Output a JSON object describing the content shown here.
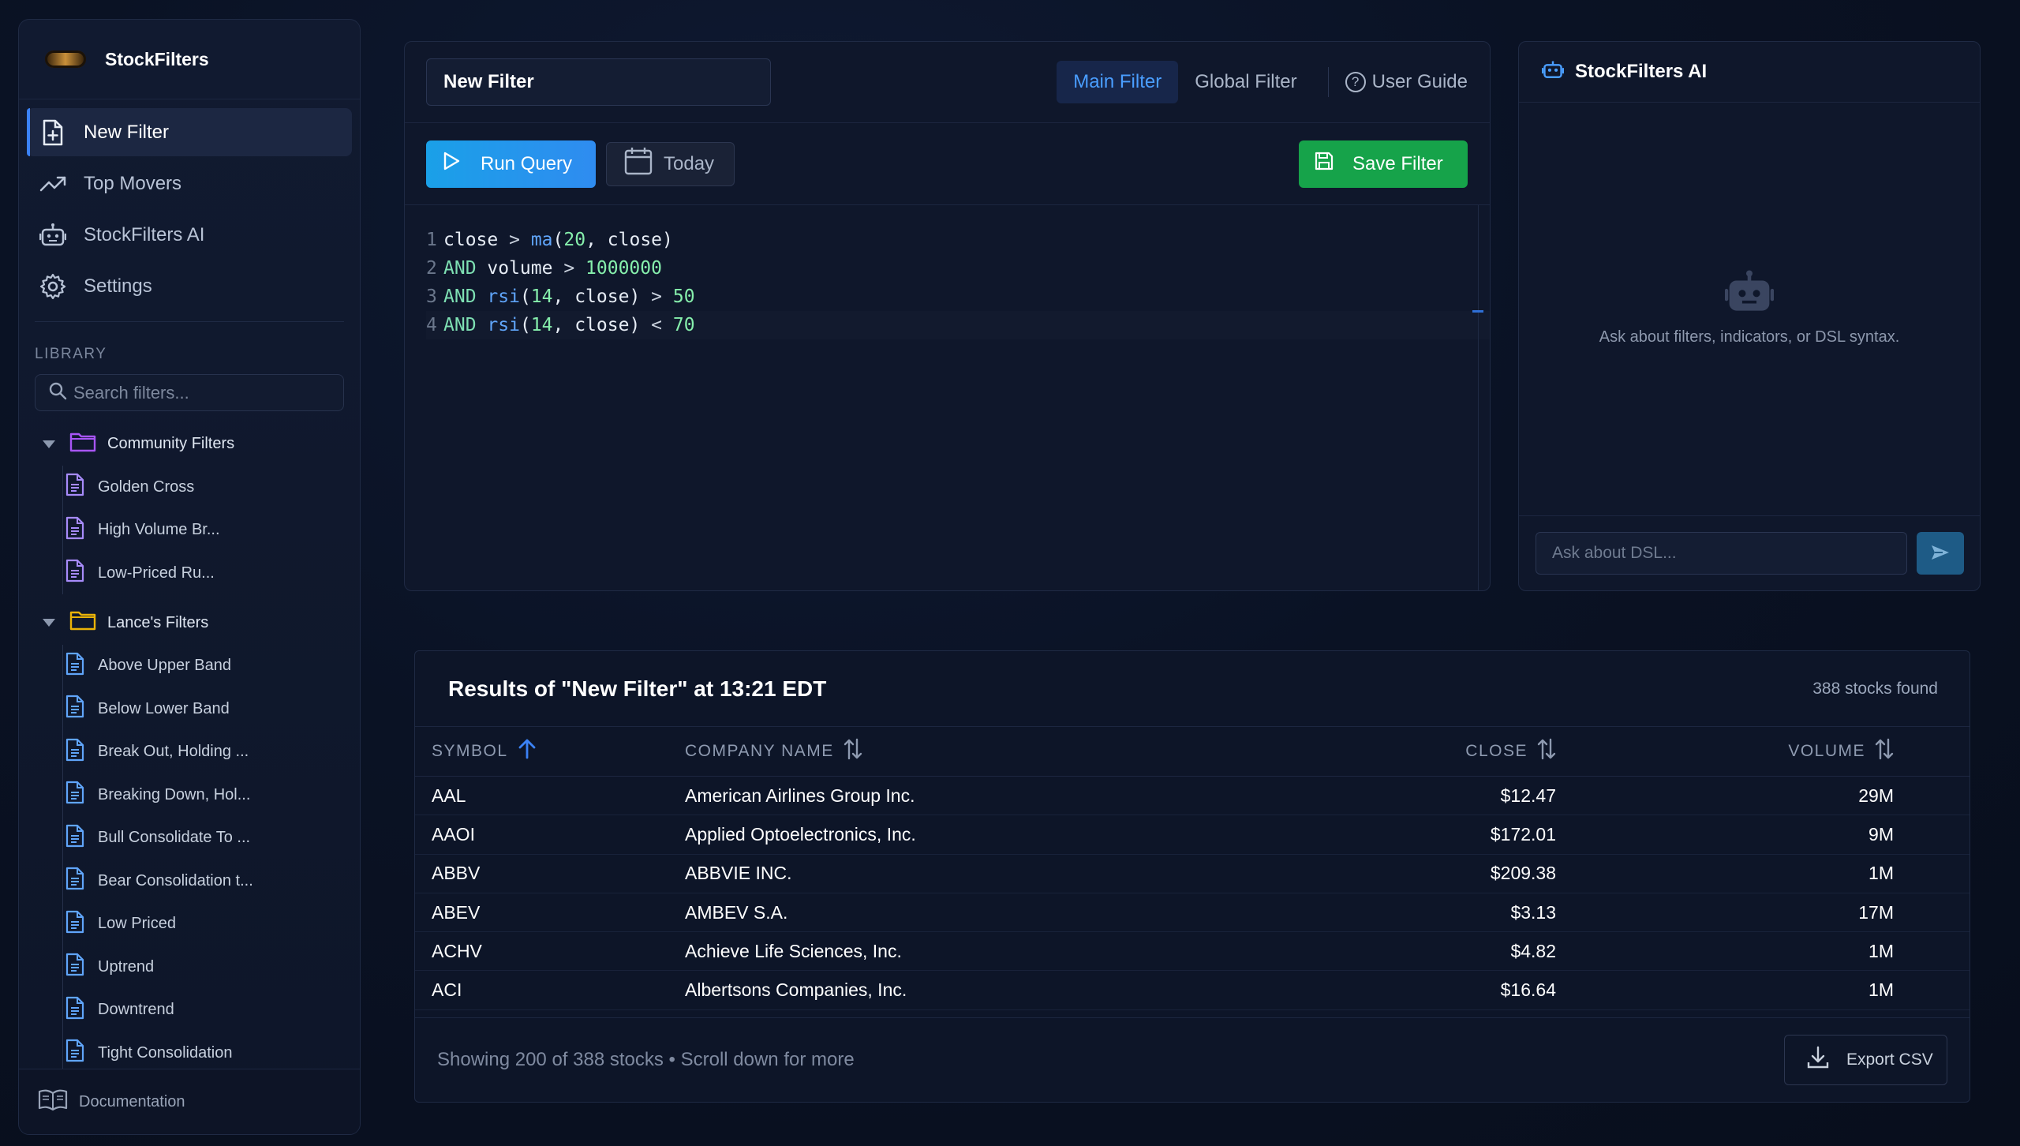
{
  "brand": {
    "name": "StockFilters"
  },
  "nav": {
    "items": [
      {
        "label": "New Filter",
        "icon": "file-plus-icon"
      },
      {
        "label": "Top Movers",
        "icon": "trending-up-icon"
      },
      {
        "label": "StockFilters AI",
        "icon": "robot-icon"
      },
      {
        "label": "Settings",
        "icon": "gear-icon"
      }
    ]
  },
  "library": {
    "label": "LIBRARY",
    "search_placeholder": "Search filters...",
    "folders": [
      {
        "name": "Community Filters",
        "color": "#a855f7",
        "files": [
          "Golden Cross",
          "High Volume Br...",
          "Low-Priced Ru..."
        ]
      },
      {
        "name": "Lance's Filters",
        "color": "#eab308",
        "files": [
          "Above Upper Band",
          "Below Lower Band",
          "Break Out, Holding ...",
          "Breaking Down, Hol...",
          "Bull Consolidate To ...",
          "Bear Consolidation t...",
          "Low Priced",
          "Uptrend",
          "Downtrend",
          "Tight Consolidation"
        ]
      }
    ],
    "file_color_purple": "#a78bfa",
    "file_color_blue": "#60a5fa"
  },
  "docs": {
    "label": "Documentation"
  },
  "editor": {
    "filter_name": "New Filter",
    "tabs": {
      "main": "Main Filter",
      "global": "Global Filter"
    },
    "user_guide": "User Guide",
    "run_label": "Run Query",
    "date_label": "Today",
    "save_label": "Save Filter",
    "code": [
      {
        "n": "1",
        "t": "close > ma(20, close)"
      },
      {
        "n": "2",
        "t": "AND volume > 1000000"
      },
      {
        "n": "3",
        "t": "AND rsi(14, close) > 50"
      },
      {
        "n": "4",
        "t": "AND rsi(14, close) < 70"
      }
    ]
  },
  "ai": {
    "title": "StockFilters AI",
    "empty_text": "Ask about filters, indicators, or DSL syntax.",
    "input_placeholder": "Ask about DSL..."
  },
  "results": {
    "title": "Results of \"New Filter\" at 13:21 EDT",
    "count": "388 stocks found",
    "columns": {
      "symbol": "SYMBOL",
      "company": "COMPANY NAME",
      "close": "CLOSE",
      "volume": "VOLUME"
    },
    "rows": [
      {
        "symbol": "AAL",
        "company": "American Airlines Group Inc.",
        "close": "$12.47",
        "volume": "29M"
      },
      {
        "symbol": "AAOI",
        "company": "Applied Optoelectronics, Inc.",
        "close": "$172.01",
        "volume": "9M"
      },
      {
        "symbol": "ABBV",
        "company": "ABBVIE INC.",
        "close": "$209.38",
        "volume": "1M"
      },
      {
        "symbol": "ABEV",
        "company": "AMBEV S.A.",
        "close": "$3.13",
        "volume": "17M"
      },
      {
        "symbol": "ACHV",
        "company": "Achieve Life Sciences, Inc.",
        "close": "$4.82",
        "volume": "1M"
      },
      {
        "symbol": "ACI",
        "company": "Albertsons Companies, Inc.",
        "close": "$16.64",
        "volume": "1M"
      }
    ],
    "footer_status": "Showing 200 of 388 stocks • Scroll down for more",
    "export_label": "Export CSV"
  },
  "colors": {
    "accent": "#3b82f6",
    "save": "#16a34a",
    "run": "#1aa0e8"
  }
}
